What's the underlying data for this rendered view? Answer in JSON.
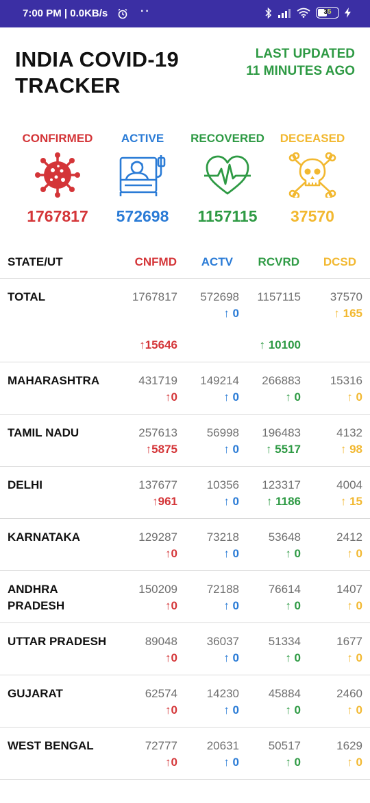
{
  "status_bar": {
    "time": "7:00 PM | 0.0KB/s",
    "battery": "35"
  },
  "header": {
    "title_line1": "INDIA COVID-19",
    "title_line2": "TRACKER",
    "updated_line1": "LAST UPDATED",
    "updated_line2": "11 MINUTES AGO"
  },
  "summary": [
    {
      "label": "CONFIRMED",
      "value": "1767817",
      "icon": "virus-icon"
    },
    {
      "label": "ACTIVE",
      "value": "572698",
      "icon": "patient-bed-icon"
    },
    {
      "label": "RECOVERED",
      "value": "1157115",
      "icon": "heartbeat-icon"
    },
    {
      "label": "DECEASED",
      "value": "37570",
      "icon": "skull-crossbones-icon"
    }
  ],
  "columns": {
    "state": "STATE/UT",
    "confirmed": "CNFMD",
    "active": "ACTV",
    "recovered": "RCVRD",
    "deceased": "DCSD"
  },
  "colors": {
    "confirmed": "#d43538",
    "active": "#2a7bd6",
    "recovered": "#2e9a44",
    "deceased": "#f2b830",
    "header_bar": "#3b2fa4"
  },
  "rows": [
    {
      "state_l1": "TOTAL",
      "state_l2": "",
      "c": "1767817",
      "cd": "↑15646",
      "a": "572698",
      "ad": "↑ 0",
      "r": "1157115",
      "rd": "↑ 10100",
      "d": "37570",
      "dd": "↑ 165"
    },
    {
      "state_l1": "MAHARASHTRA",
      "state_l2": "",
      "c": "431719",
      "cd": "↑0",
      "a": "149214",
      "ad": "↑ 0",
      "r": "266883",
      "rd": "↑ 0",
      "d": "15316",
      "dd": "↑ 0"
    },
    {
      "state_l1": "TAMIL NADU",
      "state_l2": "",
      "c": "257613",
      "cd": "↑5875",
      "a": "56998",
      "ad": "↑ 0",
      "r": "196483",
      "rd": "↑ 5517",
      "d": "4132",
      "dd": "↑ 98"
    },
    {
      "state_l1": "DELHI",
      "state_l2": "",
      "c": "137677",
      "cd": "↑961",
      "a": "10356",
      "ad": "↑ 0",
      "r": "123317",
      "rd": "↑ 1186",
      "d": "4004",
      "dd": "↑ 15"
    },
    {
      "state_l1": "KARNATAKA",
      "state_l2": "",
      "c": "129287",
      "cd": "↑0",
      "a": "73218",
      "ad": "↑ 0",
      "r": "53648",
      "rd": "↑ 0",
      "d": "2412",
      "dd": "↑ 0"
    },
    {
      "state_l1": "ANDHRA",
      "state_l2": "PRADESH",
      "c": "150209",
      "cd": "↑0",
      "a": "72188",
      "ad": "↑ 0",
      "r": "76614",
      "rd": "↑ 0",
      "d": "1407",
      "dd": "↑ 0"
    },
    {
      "state_l1": "UTTAR PRADESH",
      "state_l2": "",
      "c": "89048",
      "cd": "↑0",
      "a": "36037",
      "ad": "↑ 0",
      "r": "51334",
      "rd": "↑ 0",
      "d": "1677",
      "dd": "↑ 0"
    },
    {
      "state_l1": "GUJARAT",
      "state_l2": "",
      "c": "62574",
      "cd": "↑0",
      "a": "14230",
      "ad": "↑ 0",
      "r": "45884",
      "rd": "↑ 0",
      "d": "2460",
      "dd": "↑ 0"
    },
    {
      "state_l1": "WEST BENGAL",
      "state_l2": "",
      "c": "72777",
      "cd": "↑0",
      "a": "20631",
      "ad": "↑ 0",
      "r": "50517",
      "rd": "↑ 0",
      "d": "1629",
      "dd": "↑ 0"
    }
  ]
}
